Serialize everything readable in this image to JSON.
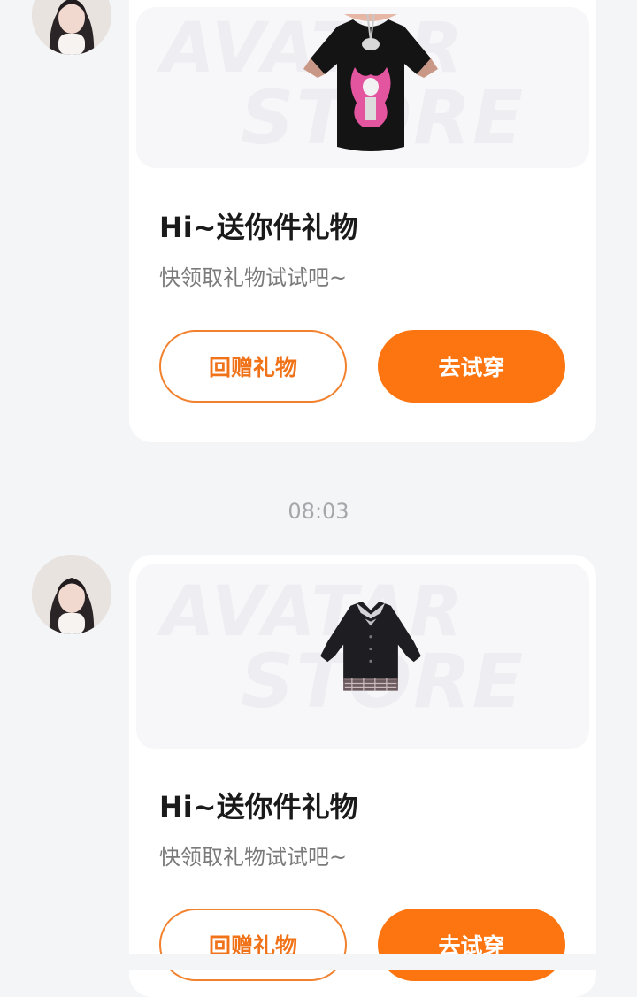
{
  "messages": [
    {
      "banner_watermark": [
        "AVATAR",
        "STORE"
      ],
      "garment_icon": "tshirt-icon",
      "title": "Hi~送你件礼物",
      "subtitle": "快领取礼物试试吧~",
      "gift_back_label": "回赠礼物",
      "try_on_label": "去试穿"
    },
    {
      "banner_watermark": [
        "AVATAR",
        "STORE"
      ],
      "garment_icon": "jacket-icon",
      "title": "Hi~送你件礼物",
      "subtitle": "快领取礼物试试吧~",
      "gift_back_label": "回赠礼物",
      "try_on_label": "去试穿"
    }
  ],
  "timestamp": "08:03",
  "colors": {
    "accent": "#fc7510",
    "background": "#f4f5f7",
    "card": "#ffffff"
  }
}
